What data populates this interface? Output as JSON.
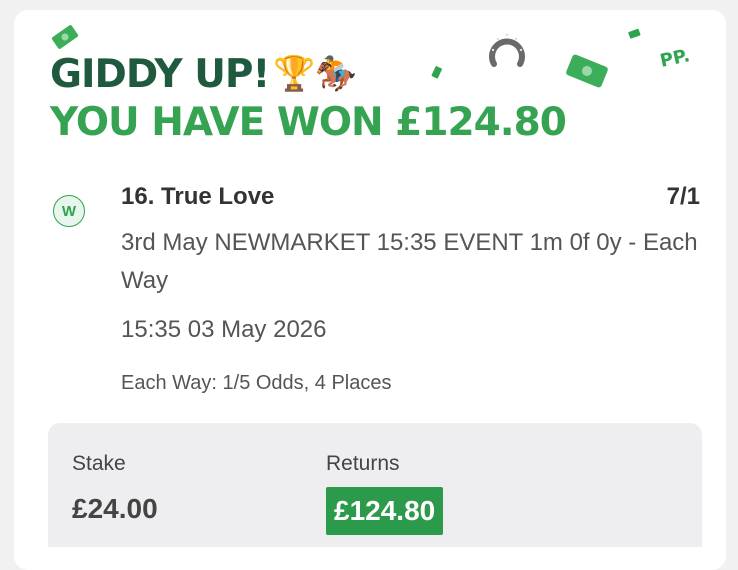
{
  "banner": {
    "line1": "GIDDY UP!",
    "line1_emojis": "🏆🏇",
    "line2": "YOU HAVE WON £124.80",
    "brand_badge": "PP.",
    "decorations": [
      "cash-note-icon",
      "horseshoe-icon",
      "confetti-icon"
    ]
  },
  "selection": {
    "result_badge": "W",
    "name": "16. True Love",
    "odds": "7/1",
    "event": "3rd May NEWMARKET 15:35 EVENT 1m 0f 0y - Each Way",
    "datetime": "15:35 03 May 2026",
    "terms": "Each Way: 1/5 Odds, 4 Places"
  },
  "summary": {
    "stake_label": "Stake",
    "stake_value": "£24.00",
    "returns_label": "Returns",
    "returns_value": "£124.80"
  },
  "colors": {
    "dark_green": "#1f5a3e",
    "bright_green": "#35a352",
    "returns_bg": "#2c9a4b",
    "panel_bg": "#eeeef1"
  }
}
